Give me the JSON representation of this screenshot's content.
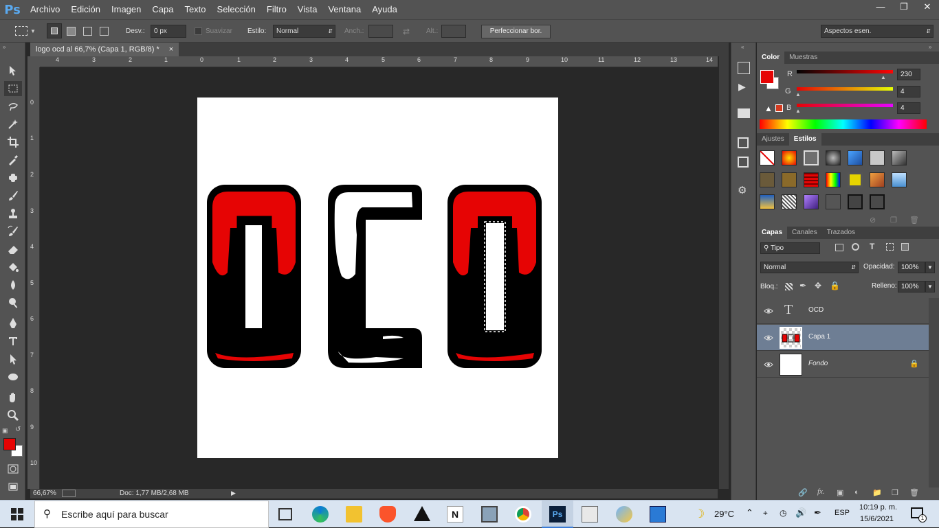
{
  "app": {
    "logo": "Ps"
  },
  "menu": [
    "Archivo",
    "Edición",
    "Imagen",
    "Capa",
    "Texto",
    "Selección",
    "Filtro",
    "Vista",
    "Ventana",
    "Ayuda"
  ],
  "options": {
    "desv_label": "Desv.:",
    "desv_value": "0 px",
    "suavizar_label": "Suavizar",
    "estilo_label": "Estilo:",
    "estilo_value": "Normal",
    "anch_label": "Anch.:",
    "alt_label": "Alt.:",
    "refine_button": "Perfeccionar bor.",
    "workspace": "Aspectos esen."
  },
  "document": {
    "tab_title": "logo ocd al 66,7% (Capa 1, RGB/8) *",
    "close": "×",
    "ruler_top": [
      "4",
      "3",
      "2",
      "1",
      "0",
      "1",
      "2",
      "3",
      "4",
      "5",
      "6",
      "7",
      "8",
      "9",
      "10",
      "11",
      "12",
      "13",
      "14"
    ],
    "ruler_left": [
      "0",
      "1",
      "2",
      "3",
      "4",
      "5",
      "6",
      "7",
      "8",
      "9",
      "10"
    ]
  },
  "status": {
    "zoom": "66,67%",
    "doc": "Doc: 1,77 MB/2,68 MB"
  },
  "color_panel": {
    "tabs": [
      "Color",
      "Muestras"
    ],
    "r_label": "R",
    "g_label": "G",
    "b_label": "B",
    "r": "230",
    "g": "4",
    "b": "4",
    "foreground": "#e60404"
  },
  "styles_panel": {
    "tabs": [
      "Ajustes",
      "Estilos"
    ]
  },
  "layers_panel": {
    "tabs": [
      "Capas",
      "Canales",
      "Trazados"
    ],
    "filter": "Tipo",
    "blend": "Normal",
    "opacity_label": "Opacidad:",
    "opacity": "100%",
    "lock_label": "Bloq.:",
    "fill_label": "Relleno:",
    "fill": "100%",
    "layers": [
      {
        "name": "OCD",
        "type": "text"
      },
      {
        "name": "Capa 1",
        "type": "image"
      },
      {
        "name": "Fondo",
        "type": "background"
      }
    ]
  },
  "taskbar": {
    "search_placeholder": "Escribe aquí para buscar",
    "weather": "29°C",
    "lang": "ESP",
    "time": "10:19 p. m.",
    "date": "15/6/2021",
    "notifications": "1"
  },
  "colors": {
    "accent_red": "#e60404",
    "ps_blue": "#5aa9ef"
  }
}
